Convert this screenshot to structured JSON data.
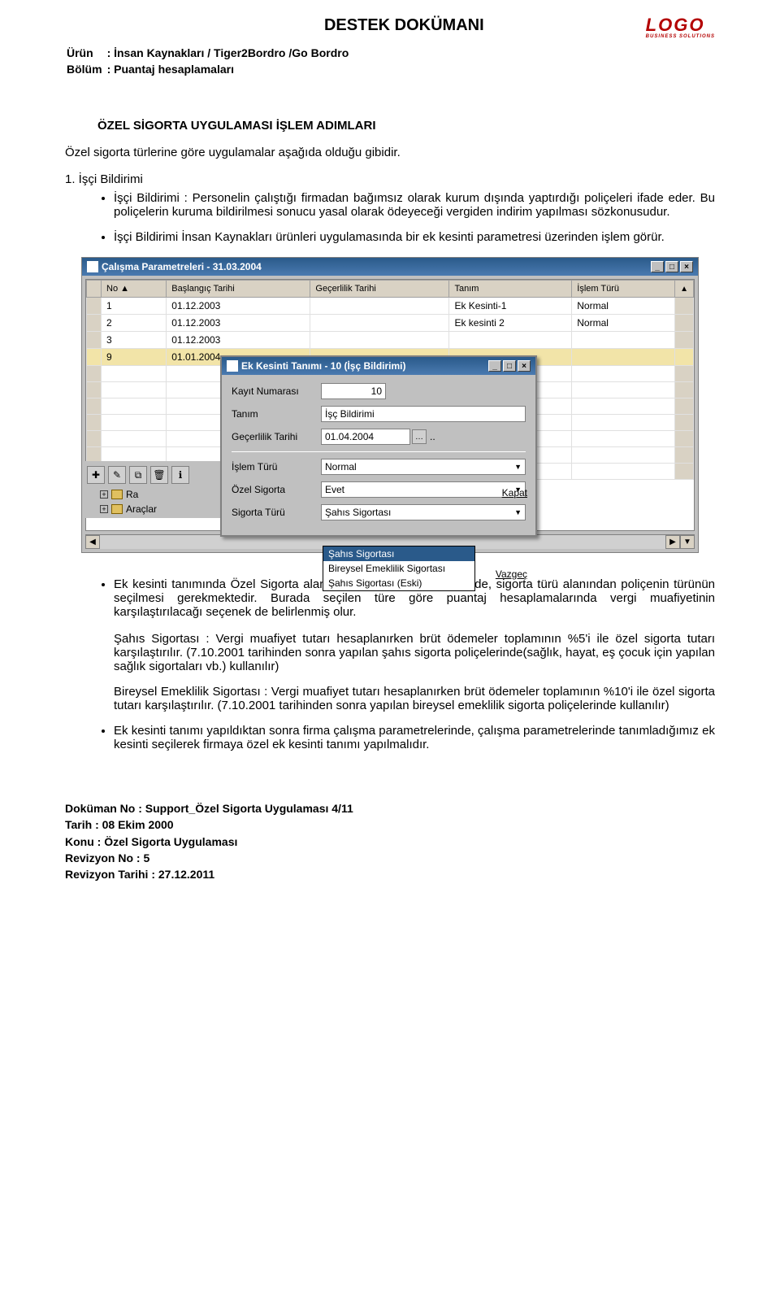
{
  "header": {
    "doc_title": "DESTEK DOKÜMANI",
    "logo_text": "LOGO",
    "logo_sub": "BUSINESS SOLUTIONS",
    "urun_label": "Ürün",
    "urun_value": ": İnsan Kaynakları / Tiger2Bordro /Go Bordro",
    "bolum_label": "Bölüm",
    "bolum_value": ": Puantaj hesaplamaları"
  },
  "section": {
    "title": "ÖZEL SİGORTA UYGULAMASI İŞLEM ADIMLARI",
    "intro": "Özel sigorta türlerine göre uygulamalar aşağıda olduğu gibidir.",
    "step1_label": "1. İşçi Bildirimi",
    "bullets_top": [
      "İşçi Bildirimi : Personelin çalıştığı firmadan bağımsız olarak kurum dışında yaptırdığı poliçeleri ifade eder. Bu poliçelerin kuruma bildirilmesi sonucu yasal olarak ödeyeceği vergiden indirim yapılması sözkonusudur.",
      "İşçi Bildirimi İnsan Kaynakları ürünleri uygulamasında bir ek kesinti parametresi üzerinden işlem görür."
    ],
    "bullets_bottom": [
      "Ek kesinti tanımında Özel Sigorta alanı \"Evet\" olarak belirlendiğinde, sigorta türü alanından poliçenin türünün seçilmesi gerekmektedir. Burada seçilen türe göre puantaj hesaplamalarında vergi muafiyetinin karşılaştırılacağı seçenek de belirlenmiş olur."
    ],
    "nested": [
      "Şahıs Sigortası : Vergi muafiyet tutarı hesaplanırken brüt ödemeler toplamının %5'i ile özel sigorta tutarı karşılaştırılır. (7.10.2001 tarihinden sonra yapılan şahıs sigorta poliçelerinde(sağlık, hayat, eş çocuk için yapılan sağlık sigortaları vb.) kullanılır)",
      "Bireysel Emeklilik Sigortası : Vergi muafiyet tutarı hesaplanırken brüt ödemeler toplamının %10'i ile özel sigorta tutarı karşılaştırılır. (7.10.2001 tarihinden sonra yapılan bireysel emeklilik sigorta poliçelerinde kullanılır)"
    ],
    "last_bullet": "Ek kesinti tanımı yapıldıktan sonra firma çalışma parametrelerinde, çalışma parametrelerinde tanımladığımız ek kesinti seçilerek firmaya özel ek kesinti tanımı yapılmalıdır."
  },
  "screenshot": {
    "outer_title": "Çalışma Parametreleri - 31.03.2004",
    "columns": [
      "No ▲",
      "Başlangıç Tarihi",
      "Geçerlilik Tarihi",
      "Tanım",
      "İşlem Türü"
    ],
    "rows": [
      {
        "no": "1",
        "bas": "01.12.2003",
        "gec": "",
        "tanim": "Ek Kesinti-1",
        "tur": "Normal"
      },
      {
        "no": "2",
        "bas": "01.12.2003",
        "gec": "",
        "tanim": "Ek kesinti 2",
        "tur": "Normal"
      },
      {
        "no": "3",
        "bas": "01.12.2003",
        "gec": "",
        "tanim": "",
        "tur": ""
      },
      {
        "no": "9",
        "bas": "01.01.2004",
        "gec": "",
        "tanim": "",
        "tur": ""
      }
    ],
    "inner_title": "Ek Kesinti Tanımı - 10 (İşç Bildirimi)",
    "fields": {
      "kayit_label": "Kayıt Numarası",
      "kayit_value": "10",
      "tanim_label": "Tanım",
      "tanim_value": "İşç Bildirimi",
      "gecer_label": "Geçerlilik Tarihi",
      "gecer_value": "01.04.2004",
      "islem_label": "İşlem Türü",
      "islem_value": "Normal",
      "ozel_label": "Özel Sigorta",
      "ozel_value": "Evet",
      "sigorta_label": "Sigorta Türü",
      "sigorta_value": "Şahıs Sigortası"
    },
    "dropdown_options": [
      "Şahıs Sigortası",
      "Bireysel Emeklilik Sigortası",
      "Şahıs Sigortası (Eski)"
    ],
    "kapat": "Kapat",
    "vazgec": "Vazgeç",
    "tree": {
      "ra": "Ra",
      "araclar": "Araçlar"
    }
  },
  "footer": {
    "l1": "Doküman No : Support_Özel Sigorta Uygulaması    4/11",
    "l2": "Tarih : 08 Ekim 2000",
    "l3": "Konu : Özel Sigorta Uygulaması",
    "l4": "Revizyon No : 5",
    "l5": "Revizyon Tarihi : 27.12.2011"
  }
}
